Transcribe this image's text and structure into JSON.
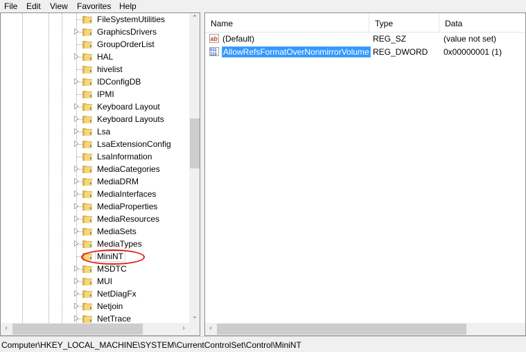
{
  "menu": [
    "File",
    "Edit",
    "View",
    "Favorites",
    "Help"
  ],
  "tree": {
    "items": [
      {
        "label": "FileSystemUtilities",
        "expandable": false
      },
      {
        "label": "GraphicsDrivers",
        "expandable": true
      },
      {
        "label": "GroupOrderList",
        "expandable": false
      },
      {
        "label": "HAL",
        "expandable": true
      },
      {
        "label": "hivelist",
        "expandable": false
      },
      {
        "label": "IDConfigDB",
        "expandable": true
      },
      {
        "label": "IPMI",
        "expandable": false
      },
      {
        "label": "Keyboard Layout",
        "expandable": true
      },
      {
        "label": "Keyboard Layouts",
        "expandable": true
      },
      {
        "label": "Lsa",
        "expandable": true
      },
      {
        "label": "LsaExtensionConfig",
        "expandable": true
      },
      {
        "label": "LsaInformation",
        "expandable": false
      },
      {
        "label": "MediaCategories",
        "expandable": true
      },
      {
        "label": "MediaDRM",
        "expandable": true
      },
      {
        "label": "MediaInterfaces",
        "expandable": true
      },
      {
        "label": "MediaProperties",
        "expandable": true
      },
      {
        "label": "MediaResources",
        "expandable": true
      },
      {
        "label": "MediaSets",
        "expandable": true
      },
      {
        "label": "MediaTypes",
        "expandable": true
      },
      {
        "label": "MiniNT",
        "expandable": false,
        "selected": true
      },
      {
        "label": "MSDTC",
        "expandable": true
      },
      {
        "label": "MUI",
        "expandable": true
      },
      {
        "label": "NetDiagFx",
        "expandable": true
      },
      {
        "label": "Netjoin",
        "expandable": true
      },
      {
        "label": "NetTrace",
        "expandable": true
      }
    ]
  },
  "list": {
    "columns": {
      "name": "Name",
      "type": "Type",
      "data": "Data"
    },
    "rows": [
      {
        "name": "(Default)",
        "type": "REG_SZ",
        "data": "(value not set)",
        "icon": "string-value-icon"
      },
      {
        "name": "AllowRefsFormatOverNonmirrorVolume",
        "type": "REG_DWORD",
        "data": "0x00000001 (1)",
        "icon": "binary-value-icon",
        "selected": true
      }
    ]
  },
  "status": {
    "path": "Computer\\HKEY_LOCAL_MACHINE\\SYSTEM\\CurrentControlSet\\Control\\MiniNT"
  },
  "annotation": {
    "color": "#e0191e",
    "target": "MiniNT"
  }
}
